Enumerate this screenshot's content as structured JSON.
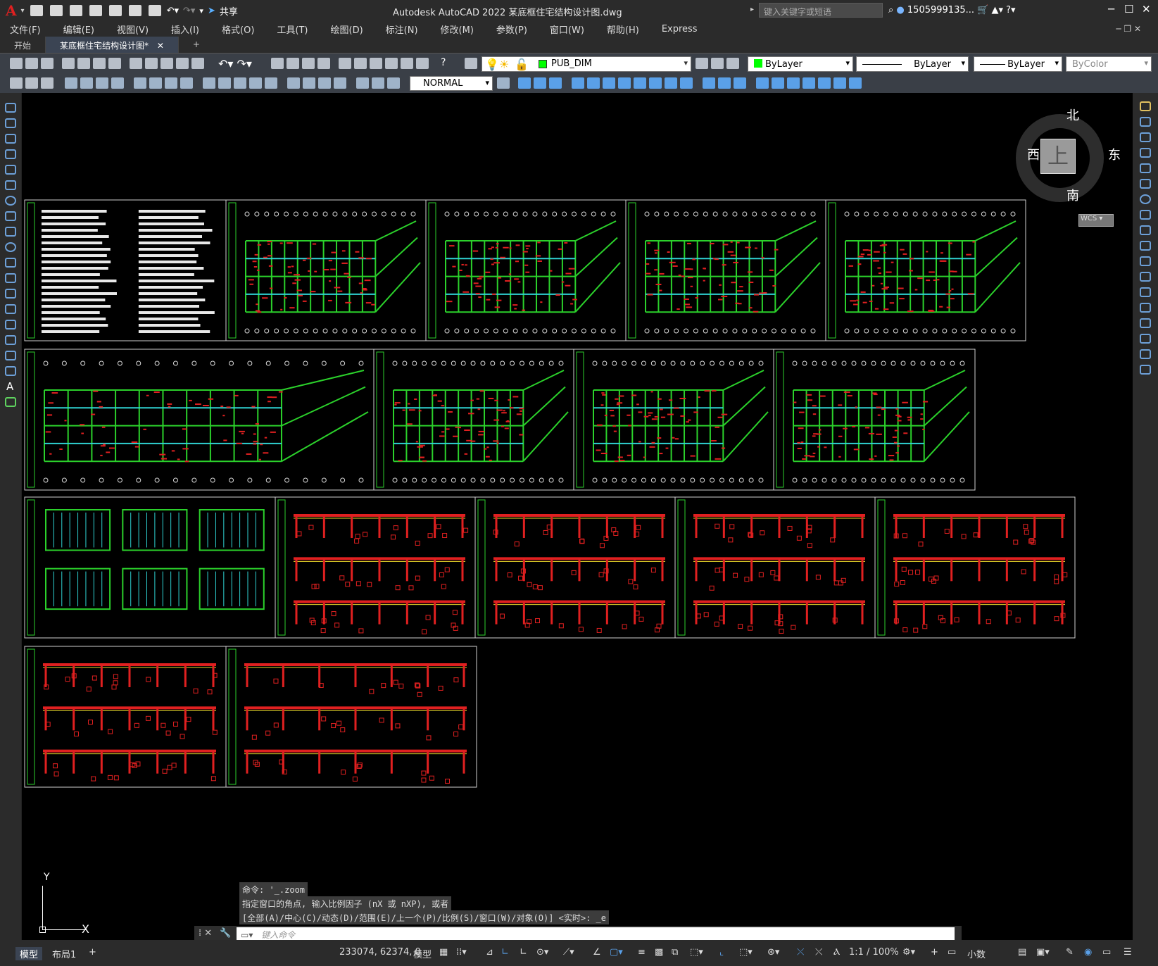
{
  "window": {
    "title": "Autodesk AutoCAD 2022    某底框住宅结构设计图.dwg",
    "share_label": "共享",
    "search_placeholder": "键入关键字或短语",
    "username": "1505999135...",
    "minimize": "─",
    "maximize": "☐",
    "close": "✕"
  },
  "menu": [
    "文件(F)",
    "编辑(E)",
    "视图(V)",
    "插入(I)",
    "格式(O)",
    "工具(T)",
    "绘图(D)",
    "标注(N)",
    "修改(M)",
    "参数(P)",
    "窗口(W)",
    "帮助(H)",
    "Express"
  ],
  "tabs": {
    "start": "开始",
    "active": "某底框住宅结构设计图*",
    "close": "✕",
    "add": "+"
  },
  "toolbar": {
    "layer_name": "PUB_DIM",
    "color": "ByLayer",
    "linetype": "ByLayer",
    "lineweight": "ByLayer",
    "plotstyle": "ByColor",
    "style_name": "NORMAL"
  },
  "viewcube": {
    "north": "北",
    "south": "南",
    "east": "东",
    "west": "西",
    "face": "上",
    "wcs": "WCS"
  },
  "ucs": {
    "y": "Y",
    "x": "X"
  },
  "command": {
    "history": [
      "命令: '_.zoom",
      "指定窗口的角点, 输入比例因子 (nX 或 nXP), 或者",
      "[全部(A)/中心(C)/动态(D)/范围(E)/上一个(P)/比例(S)/窗口(W)/对象(O)] <实时>: _e"
    ],
    "placeholder": "键入命令"
  },
  "status": {
    "model_tab": "模型",
    "layout_tab": "布局1",
    "add": "+",
    "coords": "233074, 62374, 0",
    "space": "模型",
    "scale": "1:1 / 100%",
    "units": "小数"
  },
  "colors": {
    "accent": "#3b4453",
    "green": "#2bd12b",
    "red": "#e02020",
    "cyan": "#2fd3d3",
    "yellow": "#e8d82a"
  }
}
